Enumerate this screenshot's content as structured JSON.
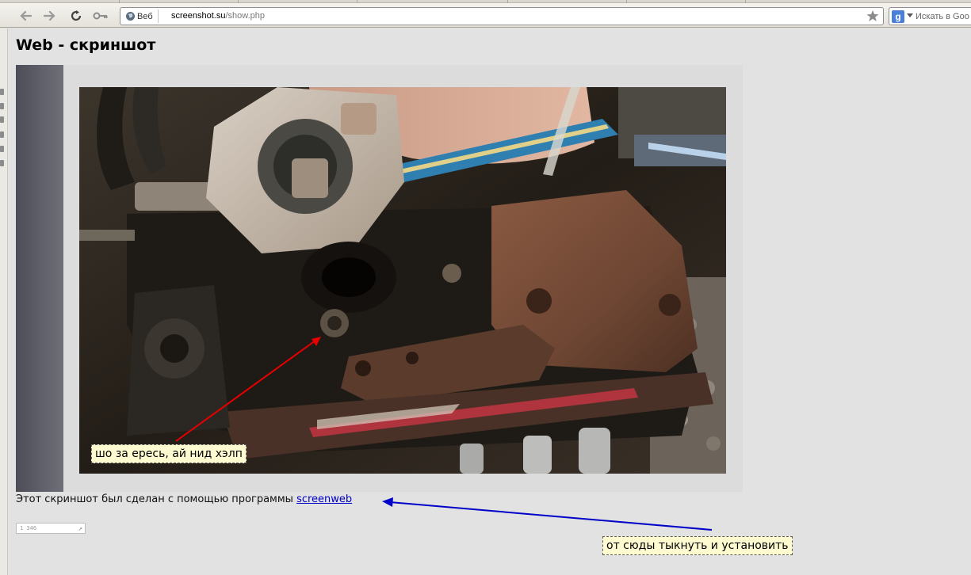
{
  "browser": {
    "toolbar": {
      "back_icon": "back-arrow-icon",
      "forward_icon": "forward-arrow-icon",
      "reload_icon": "reload-icon",
      "key_icon": "key-icon"
    },
    "address": {
      "site_label": "Веб",
      "url_host": "screenshot.su",
      "url_path": "/show.php"
    },
    "search": {
      "engine_glyph": "g",
      "placeholder": "Искать в Goo"
    }
  },
  "page": {
    "title": "Web - скриншот",
    "credit_text": "Этот скриншот был сделан с помощью программы ",
    "credit_link": "screenweb",
    "counter_value": "1 346"
  },
  "annotations": {
    "photo_callout": "шо за ересь, ай нид хэлп",
    "link_callout": "от сюды тыкнуть и установить"
  },
  "colors": {
    "red_arrow": "#e80000",
    "blue_arrow": "#0000c8",
    "callout_bg": "#fffbd0",
    "link": "#0000c8"
  }
}
